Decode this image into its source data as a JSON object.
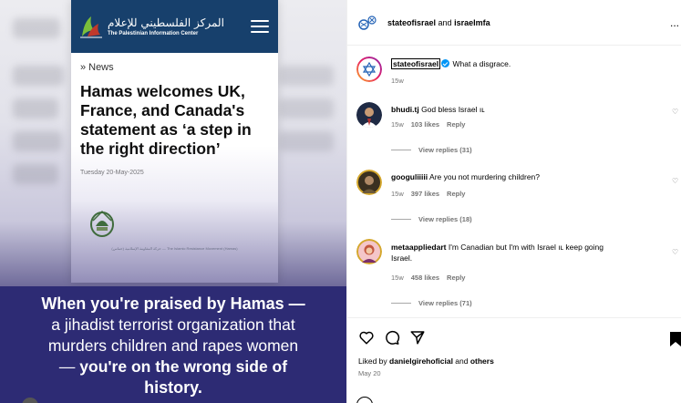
{
  "media": {
    "site_arabic": "المركز الفلسطيني للإعلام",
    "site_name": "The Palestinian Information Center",
    "breadcrumb_icon": "»",
    "breadcrumb": "News",
    "headline": "Hamas welcomes UK, France, and Canada's statement as ‘a step in the right direction’",
    "date": "Tuesday 20-May-2025",
    "emblem_caption": "حركة المقاومة الإسلامية (حماس) — The Islamic Resistance Movement (Hamas)",
    "statement_line1": "When you're praised by Hamas —",
    "statement_line2": "a jihadist terrorist organization that",
    "statement_line3": "murders children and rapes women",
    "statement_line4_pre": "— ",
    "statement_line4_bold": "you're on the wrong side of",
    "statement_line5": "history."
  },
  "post": {
    "header_user": "stateofisrael",
    "header_and": " and ",
    "header_collab": "israelmfa",
    "more_icon": "...",
    "caption_user": "stateofisrael",
    "caption_text": "What a disgrace.",
    "caption_time": "15w",
    "liked_by_prefix": "Liked by ",
    "liked_by_user": "danielgirehoficial",
    "liked_by_mid": " and ",
    "liked_by_others": "others",
    "date": "May 20"
  },
  "comments": [
    {
      "user": "bhudi.tj",
      "text": "God bless Israel ıʟ",
      "time": "15w",
      "likes": "103 likes",
      "reply": "Reply",
      "view": "View replies (31)"
    },
    {
      "user": "googuliiiii",
      "text": "Are you not murdering children?",
      "time": "15w",
      "likes": "397 likes",
      "reply": "Reply",
      "view": "View replies (18)"
    },
    {
      "user": "metaappliedart",
      "text": "I'm Canadian but I'm with Israel ıʟ keep going",
      "text2": "Israel.",
      "time": "15w",
      "likes": "458 likes",
      "reply": "Reply",
      "view": "View replies (71)"
    }
  ],
  "icons": {
    "heart": "heart-icon",
    "comment": "comment-icon",
    "share": "share-icon",
    "bookmark": "bookmark-icon",
    "menu": "hamburger-menu-icon"
  },
  "colors": {
    "pic_header": "#17406c",
    "statement_bg": "#2d2b74",
    "verified": "#0095f6"
  }
}
